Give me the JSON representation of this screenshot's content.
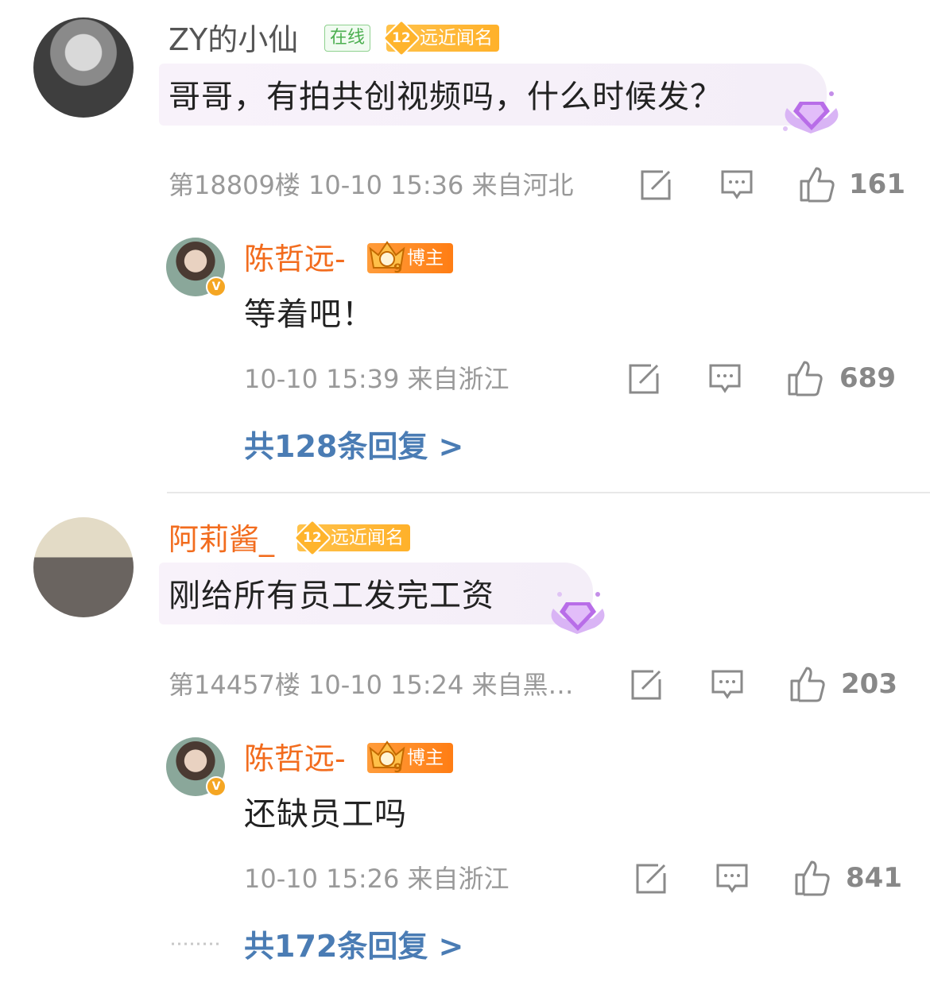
{
  "comments": [
    {
      "user": "ZY的小仙",
      "online_label": "在线",
      "level": "12",
      "level_label": "远近闻名",
      "text": "哥哥，有拍共创视频吗，什么时候发？",
      "meta": "第18809楼 10-10 15:36 来自河北",
      "likes": "161",
      "reply": {
        "user": "陈哲远-",
        "badge_level": "9",
        "badge_label": "博主",
        "text": "等着吧！",
        "meta": "10-10 15:39 来自浙江",
        "likes": "689"
      },
      "more_replies": "共128条回复 >"
    },
    {
      "user": "阿莉酱_",
      "level": "12",
      "level_label": "远近闻名",
      "text": "刚给所有员工发完工资",
      "meta": "第14457楼 10-10 15:24 来自黑…",
      "likes": "203",
      "reply": {
        "user": "陈哲远-",
        "badge_level": "9",
        "badge_label": "博主",
        "text": "还缺员工吗",
        "meta": "10-10 15:26 来自浙江",
        "likes": "841"
      },
      "more_replies": "共172条回复 >"
    }
  ],
  "colors": {
    "accent_orange": "#f26c1e",
    "link_blue": "#4a7cb4",
    "badge_gold": "#ffb42c"
  },
  "icons": [
    "edit-icon",
    "comment-icon",
    "like-icon",
    "diamond-decoration-icon",
    "verified-icon"
  ]
}
